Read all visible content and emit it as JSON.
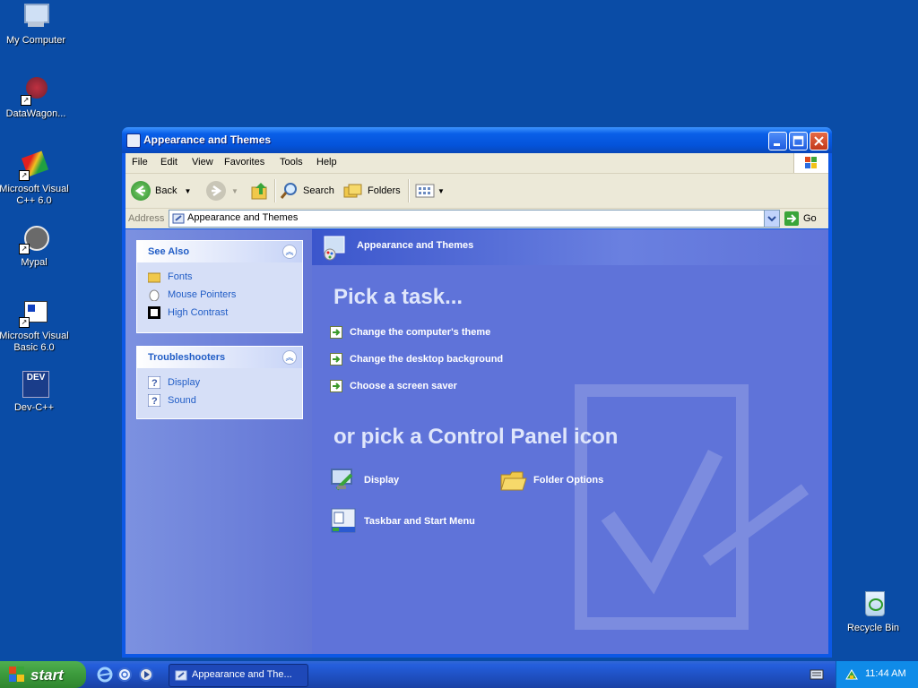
{
  "desktop": {
    "icons": [
      {
        "label": "My Computer"
      },
      {
        "label": "DataWagon..."
      },
      {
        "label": "Microsoft Visual C++ 6.0"
      },
      {
        "label": "Mypal"
      },
      {
        "label": "Microsoft Visual Basic 6.0"
      },
      {
        "label": "Dev-C++"
      },
      {
        "label": "Recycle Bin"
      }
    ]
  },
  "window": {
    "title": "Appearance and Themes",
    "menu": [
      "File",
      "Edit",
      "View",
      "Favorites",
      "Tools",
      "Help"
    ],
    "toolbar": {
      "back": "Back",
      "search": "Search",
      "folders": "Folders"
    },
    "address": {
      "label": "Address",
      "value": "Appearance and Themes",
      "go": "Go"
    },
    "see_also": {
      "title": "See Also",
      "items": [
        {
          "label": "Fonts",
          "icon": "fonts-folder-icon"
        },
        {
          "label": "Mouse Pointers",
          "icon": "mouse-icon"
        },
        {
          "label": "High Contrast",
          "icon": "high-contrast-icon"
        }
      ]
    },
    "troubleshooters": {
      "title": "Troubleshooters",
      "items": [
        {
          "label": "Display",
          "icon": "help-icon"
        },
        {
          "label": "Sound",
          "icon": "help-icon"
        }
      ]
    },
    "header": "Appearance and Themes",
    "pick_task": "Pick a task...",
    "tasks": [
      "Change the computer's theme",
      "Change the desktop background",
      "Choose a screen saver"
    ],
    "pick_icon": "or pick a Control Panel icon",
    "icons": [
      "Display",
      "Folder Options",
      "Taskbar and Start Menu"
    ]
  },
  "taskbar": {
    "start": "start",
    "task_button": "Appearance and The...",
    "clock": "11:44 AM"
  }
}
